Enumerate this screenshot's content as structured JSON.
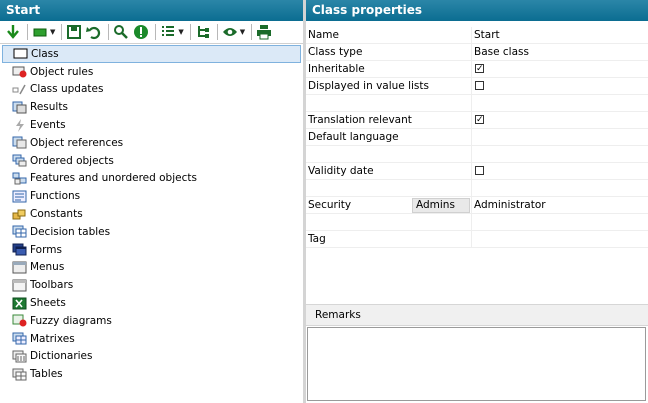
{
  "left_panel": {
    "title": "Start",
    "tree": [
      {
        "label": "Class",
        "icon": "class-icon",
        "selected": true
      },
      {
        "label": "Object rules",
        "icon": "object-rules-icon"
      },
      {
        "label": "Class updates",
        "icon": "class-updates-icon"
      },
      {
        "label": "Results",
        "icon": "results-icon"
      },
      {
        "label": "Events",
        "icon": "events-icon"
      },
      {
        "label": "Object references",
        "icon": "object-references-icon"
      },
      {
        "label": "Ordered objects",
        "icon": "ordered-objects-icon"
      },
      {
        "label": "Features and unordered objects",
        "icon": "features-icon"
      },
      {
        "label": "Functions",
        "icon": "functions-icon"
      },
      {
        "label": "Constants",
        "icon": "constants-icon"
      },
      {
        "label": "Decision tables",
        "icon": "decision-tables-icon"
      },
      {
        "label": "Forms",
        "icon": "forms-icon"
      },
      {
        "label": "Menus",
        "icon": "menus-icon"
      },
      {
        "label": "Toolbars",
        "icon": "toolbars-icon"
      },
      {
        "label": "Sheets",
        "icon": "sheets-icon"
      },
      {
        "label": "Fuzzy diagrams",
        "icon": "fuzzy-diagrams-icon"
      },
      {
        "label": "Matrixes",
        "icon": "matrixes-icon"
      },
      {
        "label": "Dictionaries",
        "icon": "dictionaries-icon"
      },
      {
        "label": "Tables",
        "icon": "tables-icon"
      }
    ]
  },
  "right_panel": {
    "title": "Class properties",
    "properties": {
      "name": {
        "label": "Name",
        "value": "Start"
      },
      "class_type": {
        "label": "Class type",
        "value": "Base class"
      },
      "inheritable": {
        "label": "Inheritable",
        "checked": true
      },
      "displayed_in_value_lists": {
        "label": "Displayed in value lists",
        "checked": false
      },
      "translation_relevant": {
        "label": "Translation relevant",
        "checked": true
      },
      "default_language": {
        "label": "Default language",
        "value": ""
      },
      "validity_date": {
        "label": "Validity date",
        "checked": false
      },
      "security": {
        "label": "Security",
        "group": "Admins",
        "value": "Administrator"
      },
      "tag": {
        "label": "Tag",
        "value": ""
      }
    },
    "remarks_label": "Remarks",
    "remarks_value": ""
  },
  "colors": {
    "header_bg": "#0b6d91",
    "selection_bg": "#dbe9f7",
    "selection_border": "#7fb2de"
  },
  "check_mark": "✓"
}
